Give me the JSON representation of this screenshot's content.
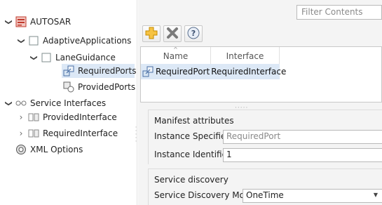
{
  "tree": {
    "root_label": "AUTOSAR",
    "adaptive_applications_label": "AdaptiveApplications",
    "lane_guidance_label": "LaneGuidance",
    "required_ports_label": "RequiredPorts",
    "provided_ports_label": "ProvidedPorts",
    "service_interfaces_label": "Service Interfaces",
    "provided_interface_label": "ProvidedInterface",
    "required_interface_label": "RequiredInterface",
    "xml_options_label": "XML Options"
  },
  "filter": {
    "placeholder": "Filter Contents"
  },
  "toolbar": {
    "icons": [
      "add-icon",
      "delete-icon",
      "help-icon"
    ]
  },
  "grid": {
    "columns": [
      "Name",
      "Interface"
    ],
    "rows": [
      {
        "name": "RequiredPort",
        "interface": "RequiredInterface"
      }
    ]
  },
  "manifest": {
    "title": "Manifest attributes",
    "instance_specifier_label": "Instance Specifier:",
    "instance_specifier_value": "RequiredPort",
    "instance_identifier_label": "Instance Identifier:",
    "instance_identifier_value": "1"
  },
  "discovery": {
    "title": "Service discovery",
    "mode_label": "Service Discovery Mode:",
    "mode_value": "OneTime"
  },
  "colors": {
    "selection": "#dce8f6",
    "panel": "#f4f4f4"
  }
}
